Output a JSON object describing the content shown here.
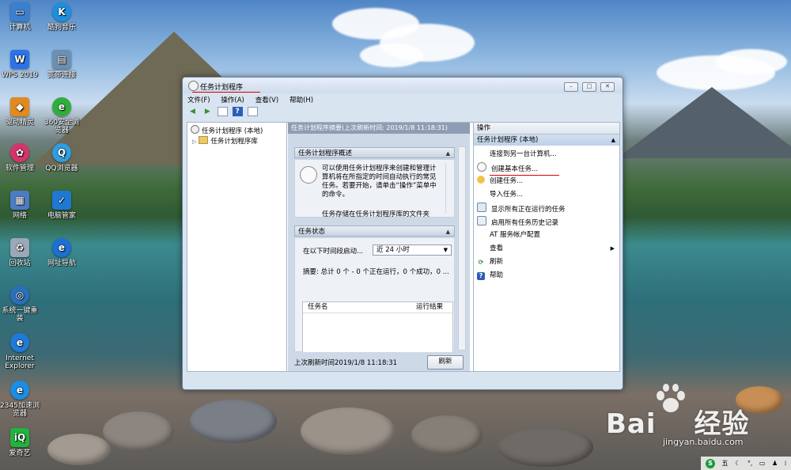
{
  "desktop": {
    "icons": [
      {
        "label": "计算机"
      },
      {
        "label": "酷狗音乐"
      },
      {
        "label": "WPS 2019"
      },
      {
        "label": "宽带连接"
      },
      {
        "label": "驱动精灵"
      },
      {
        "label": "360安全浏览器"
      },
      {
        "label": "软件管理"
      },
      {
        "label": "QQ浏览器"
      },
      {
        "label": "网络"
      },
      {
        "label": "电脑管家"
      },
      {
        "label": "回收站"
      },
      {
        "label": "网址导航"
      },
      {
        "label": "系统一键重装"
      },
      {
        "label": "Internet Explorer"
      },
      {
        "label": "2345加速浏览器"
      },
      {
        "label": "爱奇艺"
      }
    ]
  },
  "window": {
    "title": "任务计划程序",
    "menu": [
      "文件(F)",
      "操作(A)",
      "查看(V)",
      "帮助(H)"
    ],
    "controls": {
      "minimize": "–",
      "maximize": "□",
      "close": "✕"
    }
  },
  "tree": {
    "root": "任务计划程序 (本地)",
    "child": "任务计划程序库"
  },
  "middle": {
    "header": "任务计划程序摘要(上次刷新时间: 2019/1/8 11:18:31)",
    "overview_title": "任务计划程序概述",
    "overview_text": "可以使用任务计划程序来创建和管理计算机将在所指定的时间自动执行的常见任务。若要开始，请单击“操作”菜单中的命令。",
    "overview_more": "任务存储在任务计划程序库的文件夹",
    "status_title": "任务状态",
    "status_label": "在以下时间段启动...",
    "status_select": "近 24 小时",
    "summary": "摘要: 总计 0 个 - 0 个正在运行，0 个成功，0 ...",
    "col_task": "任务名",
    "col_result": "运行结果",
    "footer_text": "上次刷新时间2019/1/8 11:18:31",
    "refresh_button": "刷新"
  },
  "actions": {
    "header": "操作",
    "group": "任务计划程序 (本地)",
    "items": [
      {
        "label": "连接到另一台计算机..."
      },
      {
        "label": "创建基本任务..."
      },
      {
        "label": "创建任务..."
      },
      {
        "label": "导入任务..."
      },
      {
        "label": "显示所有正在运行的任务"
      },
      {
        "label": "启用所有任务历史记录"
      },
      {
        "label": "AT 服务帐户配置"
      },
      {
        "label": "查看"
      },
      {
        "label": "刷新"
      },
      {
        "label": "帮助"
      }
    ]
  },
  "watermark": {
    "brand": "Bai",
    "brand2": "经验",
    "url": "jingyan.baidu.com"
  },
  "tray": {
    "ime": "五"
  }
}
